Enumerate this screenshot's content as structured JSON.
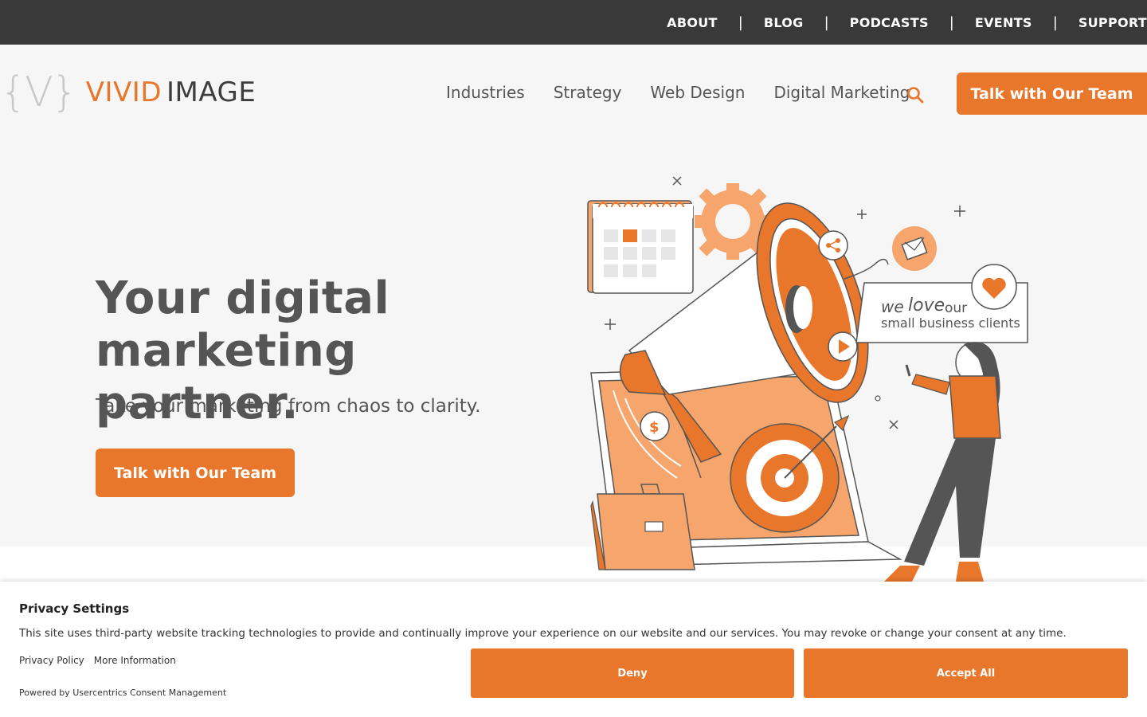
{
  "topnav": {
    "items": [
      "ABOUT",
      "BLOG",
      "PODCASTS",
      "EVENTS",
      "SUPPORT"
    ],
    "separator": "|"
  },
  "logo": {
    "bracket": "{V}",
    "word1": "VIVID",
    "word2": "IMAGE"
  },
  "mainnav": {
    "items": [
      "Industries",
      "Strategy",
      "Web Design",
      "Digital Marketing"
    ],
    "cta": "Talk with Our Team"
  },
  "hero": {
    "title_line1": "Your digital",
    "title_line2": "marketing partner.",
    "subtitle": "Take your marketing from chaos to clarity.",
    "cta": "Talk with Our Team"
  },
  "illustration": {
    "bubble_we": "we",
    "bubble_love": "love",
    "bubble_our": "our",
    "bubble_line2": "small business clients"
  },
  "consent": {
    "title": "Privacy Settings",
    "description": "This site uses third-party website tracking technologies to provide and continually improve your experience on our website and our services. You may revoke or change your consent at any time.",
    "link_privacy": "Privacy Policy",
    "link_more": "More Information",
    "powered": "Powered by Usercentrics Consent Management",
    "deny": "Deny",
    "accept": "Accept All"
  },
  "colors": {
    "accent": "#e8762b",
    "dark_bar": "#393939",
    "text": "#555555"
  }
}
